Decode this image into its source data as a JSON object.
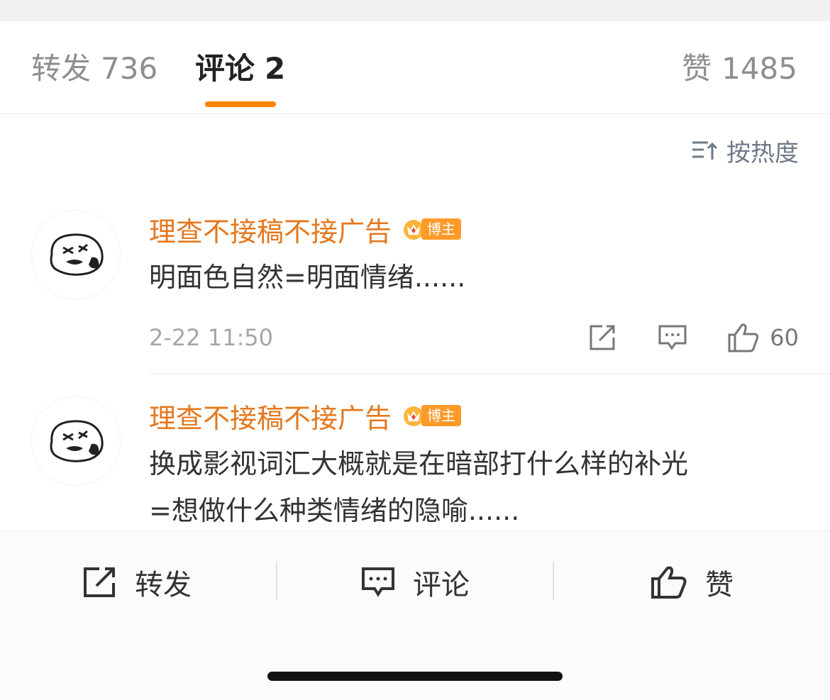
{
  "tabs": {
    "repost": {
      "label": "转发",
      "count": "736"
    },
    "comment": {
      "label": "评论",
      "count": "2"
    },
    "like": {
      "label": "赞",
      "count": "1485"
    }
  },
  "sort": {
    "label": "按热度",
    "icon": "sort-icon"
  },
  "comments": [
    {
      "username": "理查不接稿不接广告",
      "badge": "博主",
      "text_lines": [
        "明面色自然=明面情绪......"
      ],
      "time": "2-22 11:50",
      "like_count": "60"
    },
    {
      "username": "理查不接稿不接广告",
      "badge": "博主",
      "text_lines": [
        "换成影视词汇大概就是在暗部打什么样的补光",
        "=想做什么种类情绪的隐喻......"
      ]
    }
  ],
  "bottom_bar": {
    "repost": "转发",
    "comment": "评论",
    "like": "赞"
  },
  "colors": {
    "accent": "#ff8200",
    "username": "#e5781e",
    "badge": "#ff9a2a"
  }
}
